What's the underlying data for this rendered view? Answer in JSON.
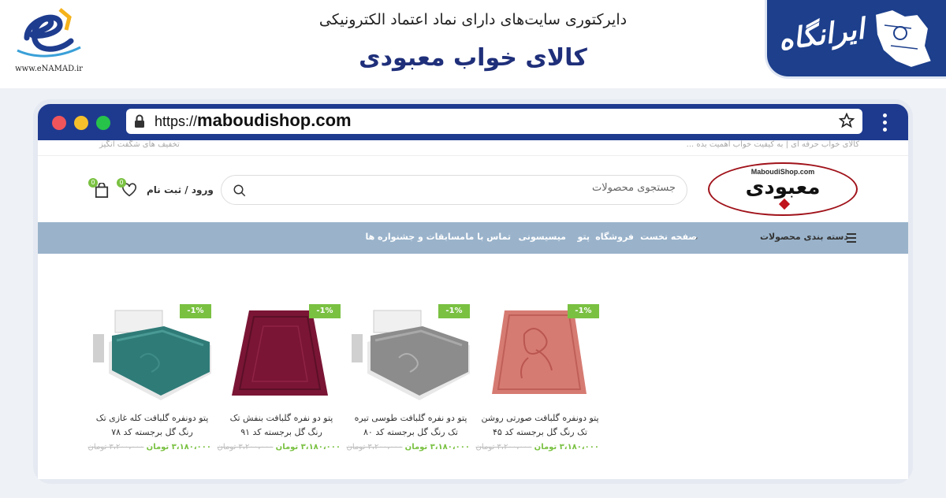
{
  "banner": {
    "subtitle": "دایرکتوری سایت‌های دارای نماد اعتماد الکترونیکی",
    "title": "کالای خواب معبودی",
    "enamad_url": "www.eNAMAD.ir",
    "brand_logo_text": "ایرانگاه"
  },
  "browser": {
    "url_protocol": "https://",
    "url_domain": "maboudishop.com"
  },
  "site": {
    "top_left_note": "تخفیف های شگفت انگیز",
    "top_right_note": "کالای خواب حرفه ای | به کیفیت خواب اهمیت بده ...",
    "logo_small": "MaboudiShop.com",
    "logo_main": "معبودی",
    "search_placeholder": "جستجوی محصولات",
    "login_label": "ورود / ثبت نام",
    "wishlist_count": "0",
    "cart_count": "0"
  },
  "nav": {
    "categories_label": "دسته بندی محصولات",
    "items": [
      "صفحه نخست",
      "فروشگاه",
      "پتو",
      "میسیسونی",
      "تماس با ما",
      "مسابقات و جشنواره ها"
    ]
  },
  "products": [
    {
      "discount": "-1%",
      "title": "پتو دونفره گلبافت صورتی روشن تک رنگ گل برجسته کد ۴۵",
      "price_new": "۳،۱۸۰،۰۰۰ تومان",
      "price_old": "۳،۲۰۰،۰۰۰ تومان",
      "image": "pink-blanket"
    },
    {
      "discount": "-1%",
      "title": "پتو دو نفره گلبافت طوسی تیره تک رنگ گل برجسته کد ۸۰",
      "price_new": "۳،۱۸۰،۰۰۰ تومان",
      "price_old": "۳،۲۰۰،۰۰۰ تومان",
      "image": "gray-blanket-bed"
    },
    {
      "discount": "-1%",
      "title": "پتو دو نفره گلبافت بنفش تک رنگ گل برجسته کد ۹۱",
      "price_new": "۳،۱۸۰،۰۰۰ تومان",
      "price_old": "۳،۲۰۰،۰۰۰ تومان",
      "image": "purple-blanket"
    },
    {
      "discount": "-1%",
      "title": "پتو دونفره گلبافت کله غازی تک رنگ گل برجسته کد ۷۸",
      "price_new": "۳،۱۸۰،۰۰۰ تومان",
      "price_old": "۳،۲۰۰،۰۰۰ تومان",
      "image": "teal-blanket-bed"
    }
  ],
  "colors": {
    "accent_green": "#7ac142",
    "nav_bg": "#9ab3cb",
    "browser_frame": "#1e3a8f",
    "title_blue": "#1f2f7a"
  }
}
